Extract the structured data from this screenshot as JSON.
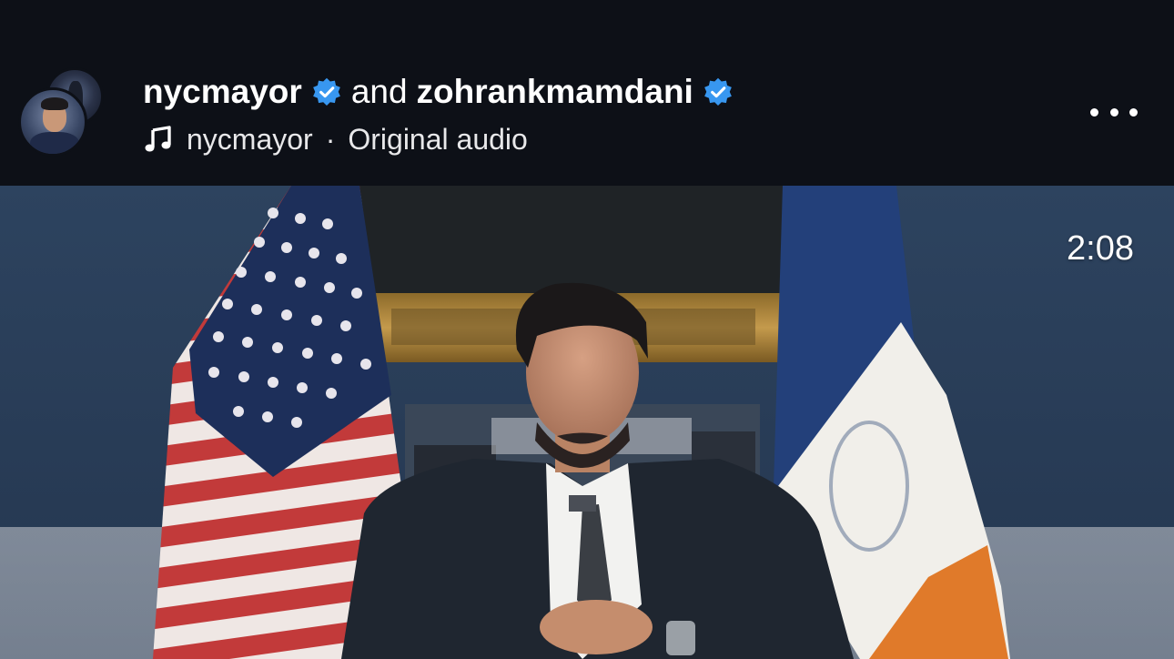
{
  "header": {
    "user_primary": "nycmayor",
    "conjunction": "and",
    "user_secondary": "zohrankmamdani",
    "audio_owner": "nycmayor",
    "audio_separator": "·",
    "audio_label": "Original audio"
  },
  "video": {
    "timestamp": "2:08"
  },
  "colors": {
    "verified_badge": "#3897f0",
    "header_bg": "#0d1017"
  },
  "icons": {
    "verified": "verified-badge-icon",
    "music": "music-note-icon",
    "more": "more-options-icon"
  }
}
